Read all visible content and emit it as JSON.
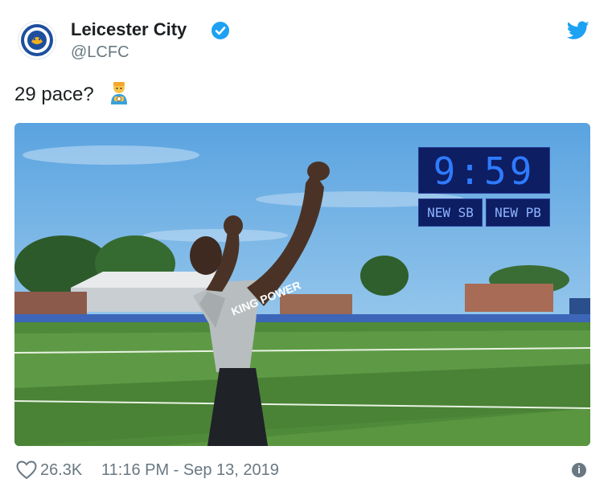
{
  "author": {
    "name": "Leicester City",
    "handle": "@LCFC"
  },
  "tweet": {
    "text": "29 pace?",
    "emoji": "person-with-ball-icon"
  },
  "media": {
    "timer": "9:59",
    "badges": [
      "NEW SB",
      "NEW PB"
    ],
    "shirt_text": "KING POWER"
  },
  "footer": {
    "likes": "26.3K",
    "timestamp": "11:16 PM - Sep 13, 2019"
  },
  "colors": {
    "accent": "#1da1f2",
    "muted": "#697882",
    "scoreboard": "#0d1e63"
  }
}
